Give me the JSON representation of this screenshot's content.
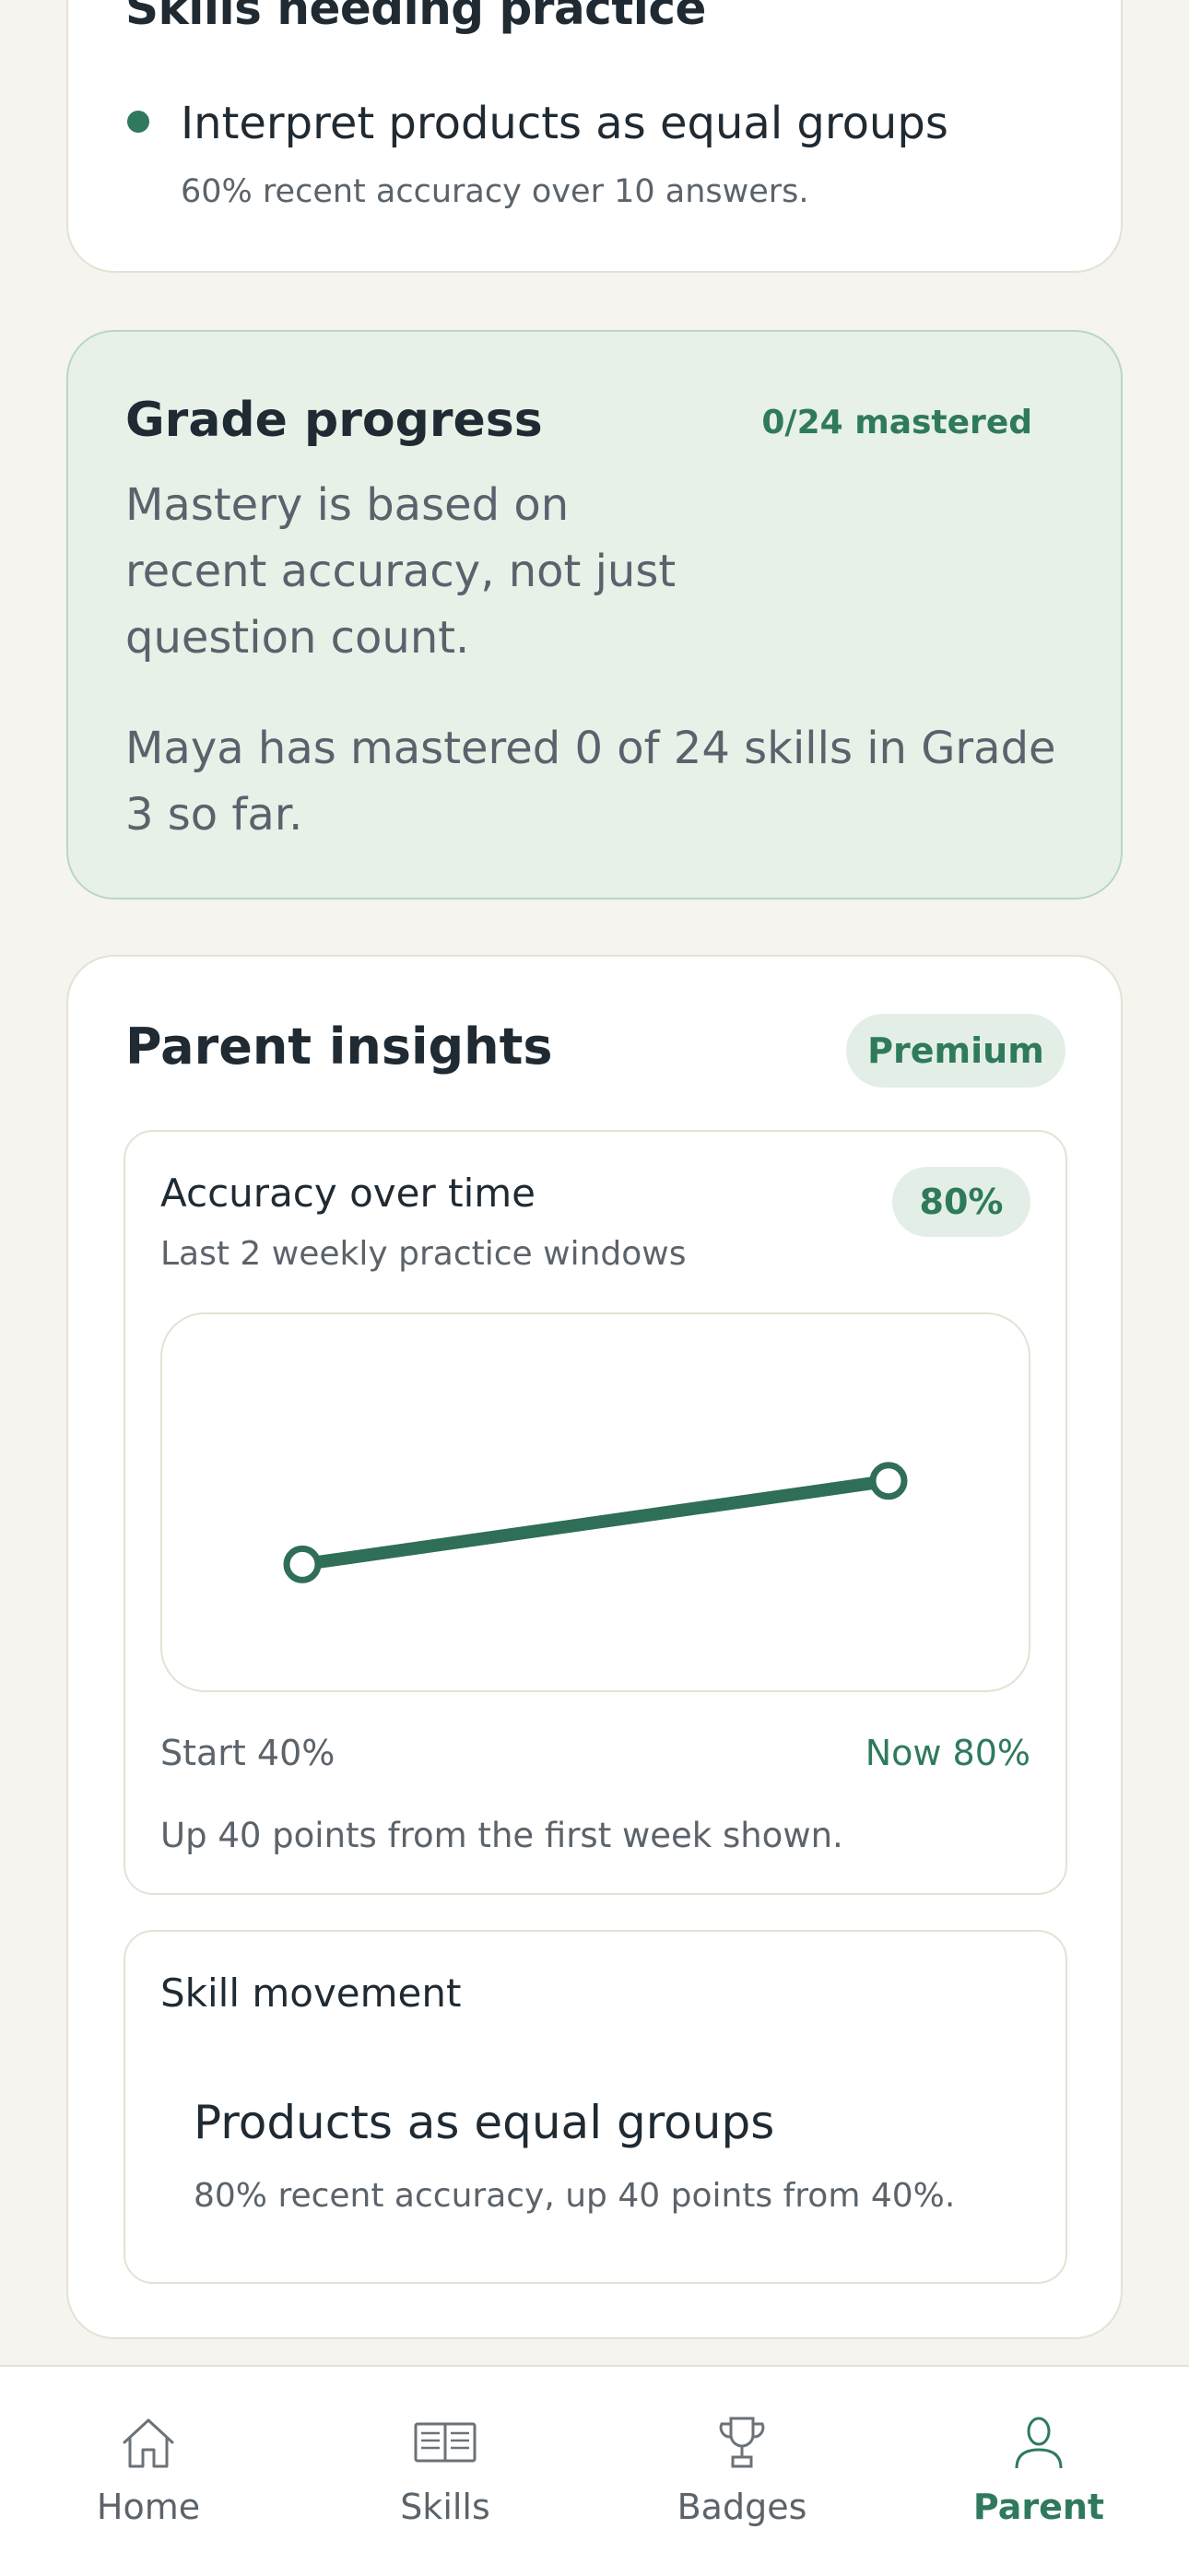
{
  "practice": {
    "title": "Skills needing practice",
    "skill": "Interpret products as equal groups",
    "detail": "60% recent accuracy over 10 answers."
  },
  "grade": {
    "title": "Grade progress",
    "badge": "0/24 mastered",
    "description": "Mastery is based on recent accuracy, not just question count.",
    "summary": "Maya has mastered 0 of 24 skills in Grade 3 so far."
  },
  "insights": {
    "title": "Parent insights",
    "premium": "Premium",
    "accuracy": {
      "title": "Accuracy over time",
      "subtitle": "Last 2 weekly practice windows",
      "badge": "80%",
      "start_label": "Start 40%",
      "now_label": "Now 80%",
      "note": "Up 40 points from the first week shown."
    },
    "movement": {
      "title": "Skill movement",
      "skill": "Products as equal groups",
      "detail": "80% recent accuracy, up 40 points from 40%."
    }
  },
  "chart_data": {
    "type": "line",
    "x": [
      1,
      2
    ],
    "values": [
      40,
      80
    ],
    "ylim": [
      0,
      100
    ],
    "grid": false,
    "color": "#2f6e57"
  },
  "nav": {
    "items": [
      {
        "label": "Home",
        "icon": "home-icon"
      },
      {
        "label": "Skills",
        "icon": "book-icon"
      },
      {
        "label": "Badges",
        "icon": "trophy-icon"
      },
      {
        "label": "Parent",
        "icon": "person-icon"
      }
    ],
    "active": "Parent",
    "accent": "#2f7a5c"
  }
}
